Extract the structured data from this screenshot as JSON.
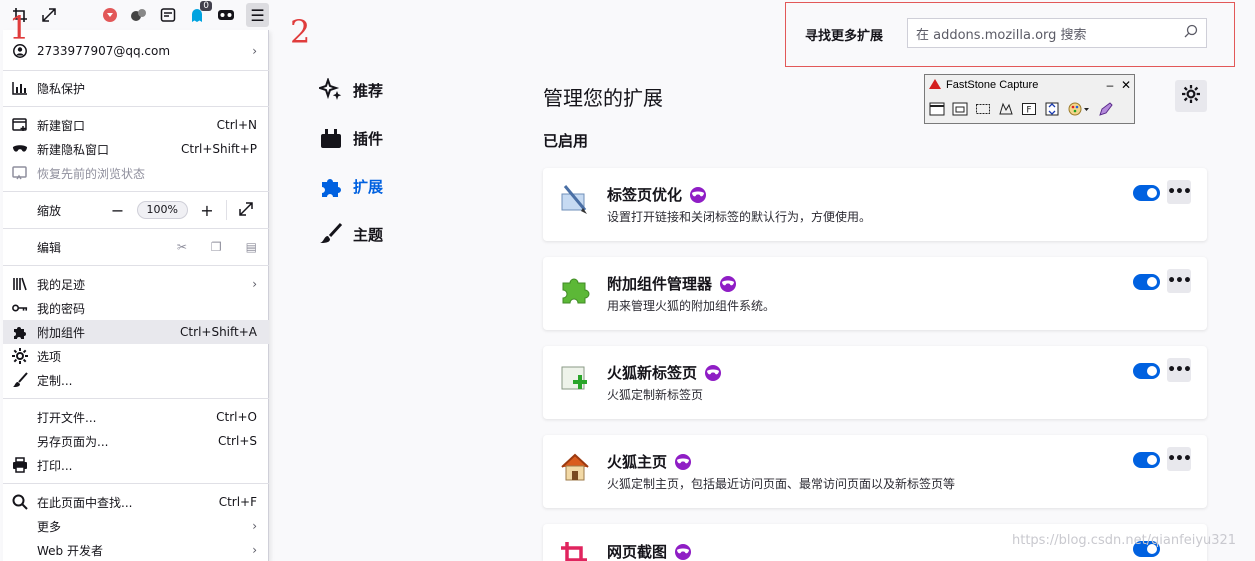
{
  "app_menu": {
    "account": "2733977907@qq.com",
    "privacy": "隐私保护",
    "new_window": "新建窗口",
    "new_window_shortcut": "Ctrl+N",
    "private_window": "新建隐私窗口",
    "private_window_shortcut": "Ctrl+Shift+P",
    "restore_session": "恢复先前的浏览状态",
    "zoom_label": "缩放",
    "zoom_value": "100%",
    "edit_label": "编辑",
    "library": "我的足迹",
    "passwords": "我的密码",
    "addons": "附加组件",
    "addons_shortcut": "Ctrl+Shift+A",
    "options": "选项",
    "customize": "定制...",
    "open_file": "打开文件...",
    "open_file_shortcut": "Ctrl+O",
    "save_page": "另存页面为...",
    "save_page_shortcut": "Ctrl+S",
    "print": "打印...",
    "find_in_page": "在此页面中查找...",
    "find_shortcut": "Ctrl+F",
    "more": "更多",
    "web_developer": "Web 开发者"
  },
  "toolbar": {
    "notification_count": "0",
    "menu_glyph": "☰"
  },
  "annotations": {
    "one": "1",
    "two": "2"
  },
  "search": {
    "label": "寻找更多扩展",
    "placeholder": "在 addons.mozilla.org 搜索"
  },
  "categories": [
    "推荐",
    "插件",
    "扩展",
    "主题"
  ],
  "page_title": "管理您的扩展",
  "section_enabled": "已启用",
  "extensions": [
    {
      "name": "标签页优化",
      "description": "设置打开链接和关闭标签的默认行为，方便使用。",
      "icon": "quill-icon",
      "enabled": true
    },
    {
      "name": "附加组件管理器",
      "description": "用来管理火狐的附加组件系统。",
      "icon": "puzzle-icon",
      "enabled": true
    },
    {
      "name": "火狐新标签页",
      "description": "火狐定制新标签页",
      "icon": "new-tab-icon",
      "enabled": true
    },
    {
      "name": "火狐主页",
      "description": "火狐定制主页，包括最近访问页面、最常访问页面以及新标签页等",
      "icon": "house-icon",
      "enabled": true
    },
    {
      "name": "网页截图",
      "description": "",
      "icon": "crop-icon",
      "enabled": true
    }
  ],
  "faststone": {
    "title": "FastStone Capture",
    "minimize": "–",
    "close": "✕"
  },
  "watermark": "https://blog.csdn.net/qianfeiyu321",
  "colors": {
    "accent": "#0061e0",
    "private_badge": "#8f1dc5",
    "annotation": "#e03c3c"
  }
}
